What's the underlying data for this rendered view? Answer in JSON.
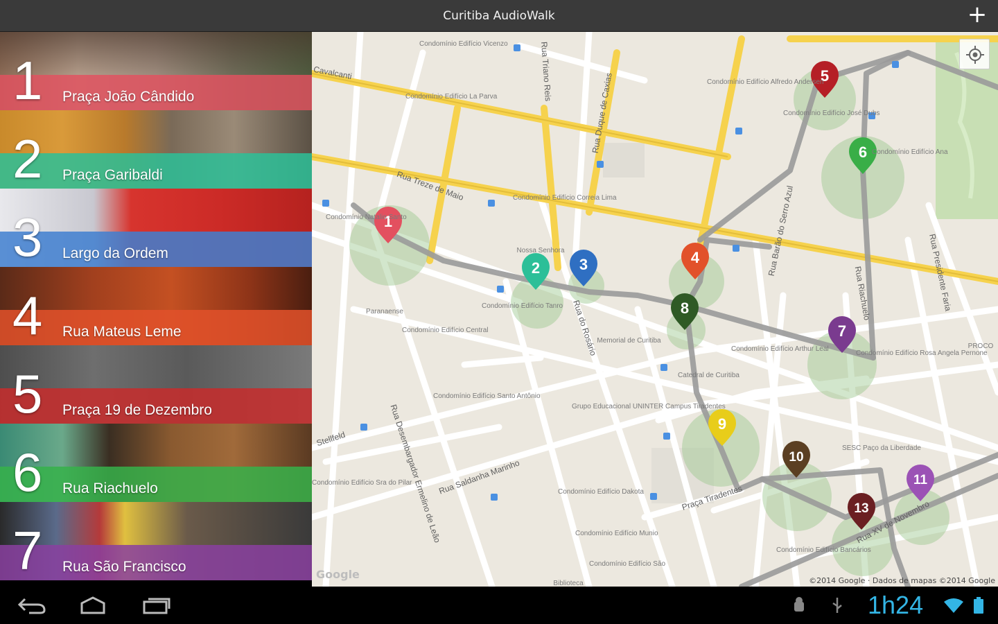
{
  "app": {
    "title": "Curitiba AudioWalk",
    "add_label": "+"
  },
  "stops": [
    {
      "number": "1",
      "name": "Praça João Cândido",
      "color": "#e3505f"
    },
    {
      "number": "2",
      "name": "Praça Garibaldi",
      "color": "#2cbf98"
    },
    {
      "number": "3",
      "name": "Largo da Ordem",
      "color": "#3f7fd0"
    },
    {
      "number": "4",
      "name": "Rua Mateus Leme",
      "color": "#e2512a"
    },
    {
      "number": "5",
      "name": "Praça 19 de Dezembro",
      "color": "#c82c2c"
    },
    {
      "number": "6",
      "name": "Rua Riachuelo",
      "color": "#36b24a"
    },
    {
      "number": "7",
      "name": "Rua São Francisco",
      "color": "#8a3fa0"
    }
  ],
  "map": {
    "markers": [
      {
        "label": "1",
        "color": "#e3505f"
      },
      {
        "label": "2",
        "color": "#2cbf98"
      },
      {
        "label": "3",
        "color": "#2f6fc2"
      },
      {
        "label": "4",
        "color": "#e2512a"
      },
      {
        "label": "5",
        "color": "#b51f26"
      },
      {
        "label": "6",
        "color": "#39ae47"
      },
      {
        "label": "7",
        "color": "#7a3b8f"
      },
      {
        "label": "8",
        "color": "#2f5a25"
      },
      {
        "label": "9",
        "color": "#e8cd1a"
      },
      {
        "label": "10",
        "color": "#5b3f22"
      },
      {
        "label": "11",
        "color": "#9b52b5"
      },
      {
        "label": "13",
        "color": "#6b1f22"
      }
    ],
    "streets": {
      "cavalcanti": "Cavalcanti",
      "treze_de_maio": "Rua Treze de Maio",
      "saldanha": "Rua Saldanha Marinho",
      "desembargador": "Rua Desembargador Ermelino de Leão",
      "do_rosario": "Rua do Rosário",
      "riachuelo": "Rua Riachuelo",
      "barao": "Rua Barão do Serro Azul",
      "presidente_faria": "Rua Presidente Faria",
      "tiradentes": "Praça Tiradentes",
      "quinze": "Rua XV de Novembro",
      "stellfeld": "Stellfeld",
      "triano_reis": "Rua Triano Reis",
      "duque": "Rua Duque de Caxias"
    },
    "places": {
      "memorial": "Memorial de Curitiba",
      "catedral": "Catedral de Curitiba",
      "uninter": "Grupo Educacional UNINTER Campus Tiradentes",
      "sesc": "SESC Paço da Liberdade",
      "paranaense": "Paranaense",
      "procon": "PROCO",
      "cond_vicenzo": "Condomínio Edifício Vicenzo",
      "cond_laparva": "Condomínio Edifício La Parva",
      "cond_alfredo": "Condomínio Edifício Alfredo Andersen",
      "cond_jose": "Condomínio Edifício José Dubs",
      "cond_ana": "Condomínio Edifício Ana",
      "cond_natalio": "Condomínio Natalio Santo",
      "cond_correia": "Condomínio Edifício Correia Lima",
      "cond_nossa": "Nossa Senhora",
      "cond_tanro": "Condomínio Edifício Tanro",
      "cond_central": "Condomínio Edifício Central",
      "cond_arthur": "Condomínio Edifício Arthur Leal",
      "cond_rosa": "Condomínio Edifício Rosa Angela Pernone",
      "cond_santo": "Condomínio Edifício Santo Antônio",
      "cond_pilar": "Condomínio Edifício Sra do Pilar",
      "cond_dakota": "Condomínio Edifício Dakota",
      "cond_munio": "Condomínio Edifício Munio",
      "cond_sao": "Condomínio Edifício São",
      "cond_bancarios": "Condomínio Edifício Bancários",
      "biblioteca": "Biblioteca"
    },
    "google": "Google",
    "attribution": "©2014 Google · Dados de mapas ©2014 Google"
  },
  "statusbar": {
    "time": "1h24"
  }
}
